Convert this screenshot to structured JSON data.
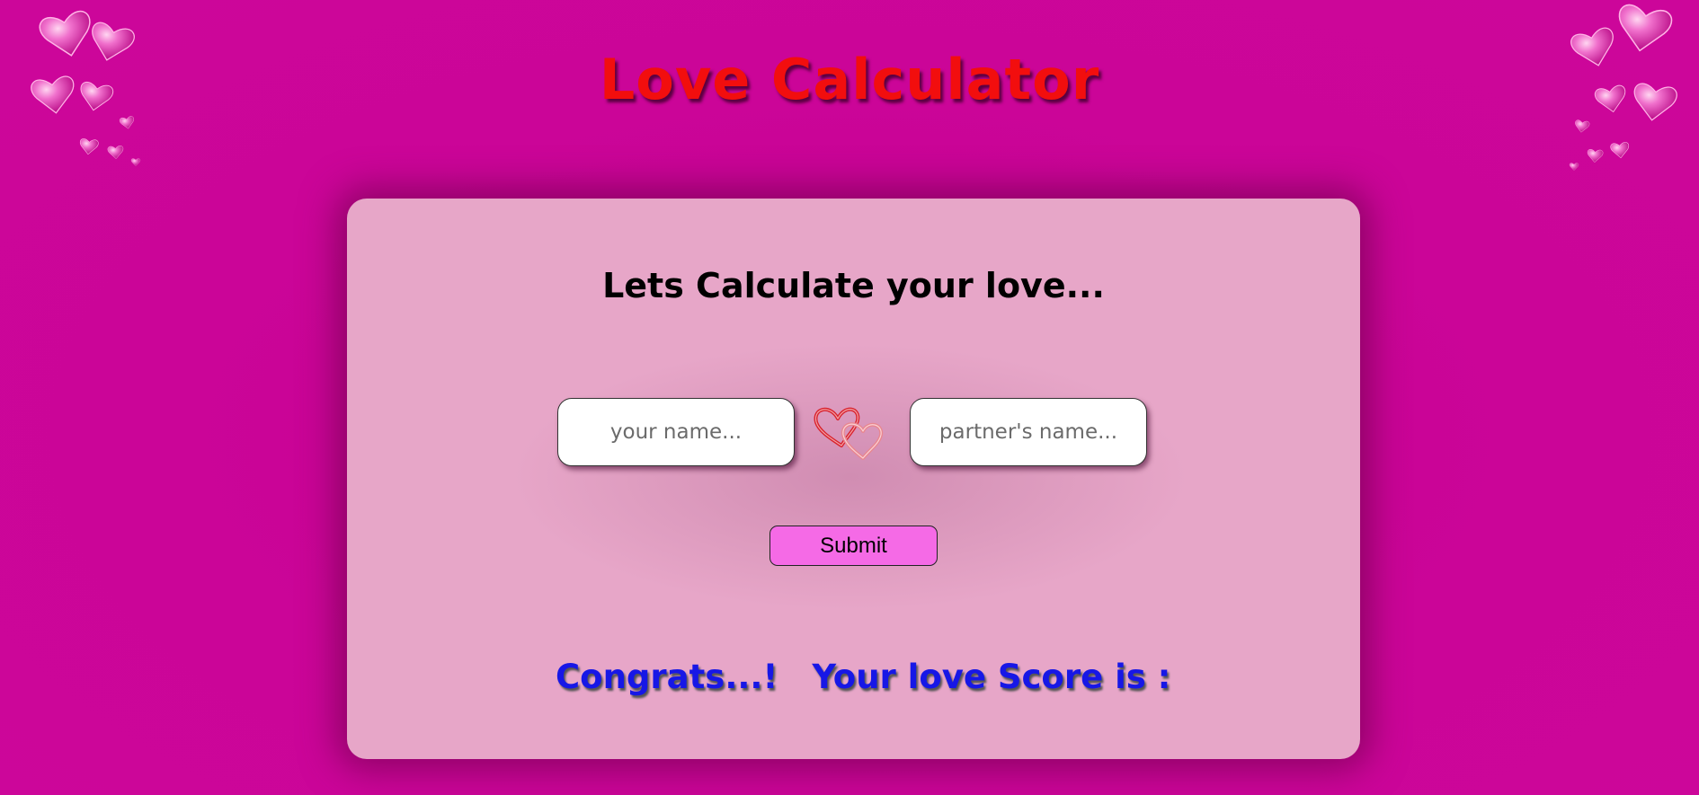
{
  "page": {
    "title": "Love Calculator"
  },
  "card": {
    "heading": "Lets Calculate your love...",
    "your_name": {
      "value": "",
      "placeholder": "your name..."
    },
    "partner_name": {
      "value": "",
      "placeholder": "partner's name..."
    },
    "submit_label": "Submit",
    "result": {
      "congrats": "Congrats...!",
      "score_label": "Your love Score is :",
      "score_value": ""
    }
  },
  "icons": {
    "corner_left": "hearts-decoration-icon",
    "corner_right": "hearts-decoration-icon",
    "center": "linked-hearts-icon"
  },
  "colors": {
    "background": "#cc0599",
    "card": "#e7a6c8",
    "title": "#f20e0e",
    "result_text": "#1717e6",
    "submit_button": "#f56ae6"
  }
}
